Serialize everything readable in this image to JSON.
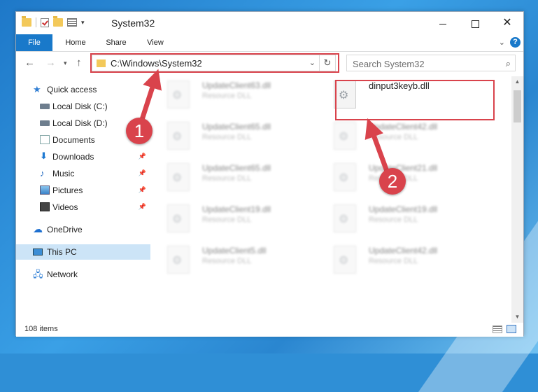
{
  "window": {
    "title": "System32",
    "controls": {
      "minimize": "–",
      "maximize": "☐",
      "close": "✕"
    }
  },
  "ribbon": {
    "tabs": [
      "File",
      "Home",
      "Share",
      "View"
    ],
    "help": "?"
  },
  "nav": {
    "address": "C:\\Windows\\System32",
    "search_placeholder": "Search System32"
  },
  "sidebar": {
    "items": [
      {
        "label": "Quick access",
        "icon": "star-icon"
      },
      {
        "label": "Local Disk (C:)",
        "icon": "disk-icon"
      },
      {
        "label": "Local Disk (D:)",
        "icon": "disk-icon"
      },
      {
        "label": "Documents",
        "icon": "documents-icon",
        "pinned": true
      },
      {
        "label": "Downloads",
        "icon": "downloads-icon",
        "pinned": true
      },
      {
        "label": "Music",
        "icon": "music-icon",
        "pinned": true
      },
      {
        "label": "Pictures",
        "icon": "pictures-icon",
        "pinned": true
      },
      {
        "label": "Videos",
        "icon": "videos-icon",
        "pinned": true
      },
      {
        "label": "OneDrive",
        "icon": "onedrive-icon"
      },
      {
        "label": "This PC",
        "icon": "this-pc-icon",
        "selected": true
      },
      {
        "label": "Network",
        "icon": "network-icon"
      }
    ]
  },
  "files": {
    "left": [
      {
        "name": "UpdateClient63.dll",
        "type": "Resource DLL"
      },
      {
        "name": "UpdateClient65.dll",
        "type": "Resource DLL"
      },
      {
        "name": "UpdateClient65.dll",
        "type": "Resource DLL"
      },
      {
        "name": "UpdateClient19.dll",
        "type": "Resource DLL"
      },
      {
        "name": "UpdateClient5.dll",
        "type": "Resource DLL"
      }
    ],
    "right": [
      {
        "name": "dinput3keyb.dll",
        "type": ""
      },
      {
        "name": "UpdateClient42.dll",
        "type": "Resource DLL"
      },
      {
        "name": "UpdateClient21.dll",
        "type": "Resource DLL"
      },
      {
        "name": "UpdateClient19.dll",
        "type": "Resource DLL"
      },
      {
        "name": "UpdateClient42.dll",
        "type": "Resource DLL"
      }
    ]
  },
  "status": {
    "item_count": "108 items"
  },
  "annotations": {
    "step1": "1",
    "step2": "2",
    "color": "#d9434c"
  }
}
